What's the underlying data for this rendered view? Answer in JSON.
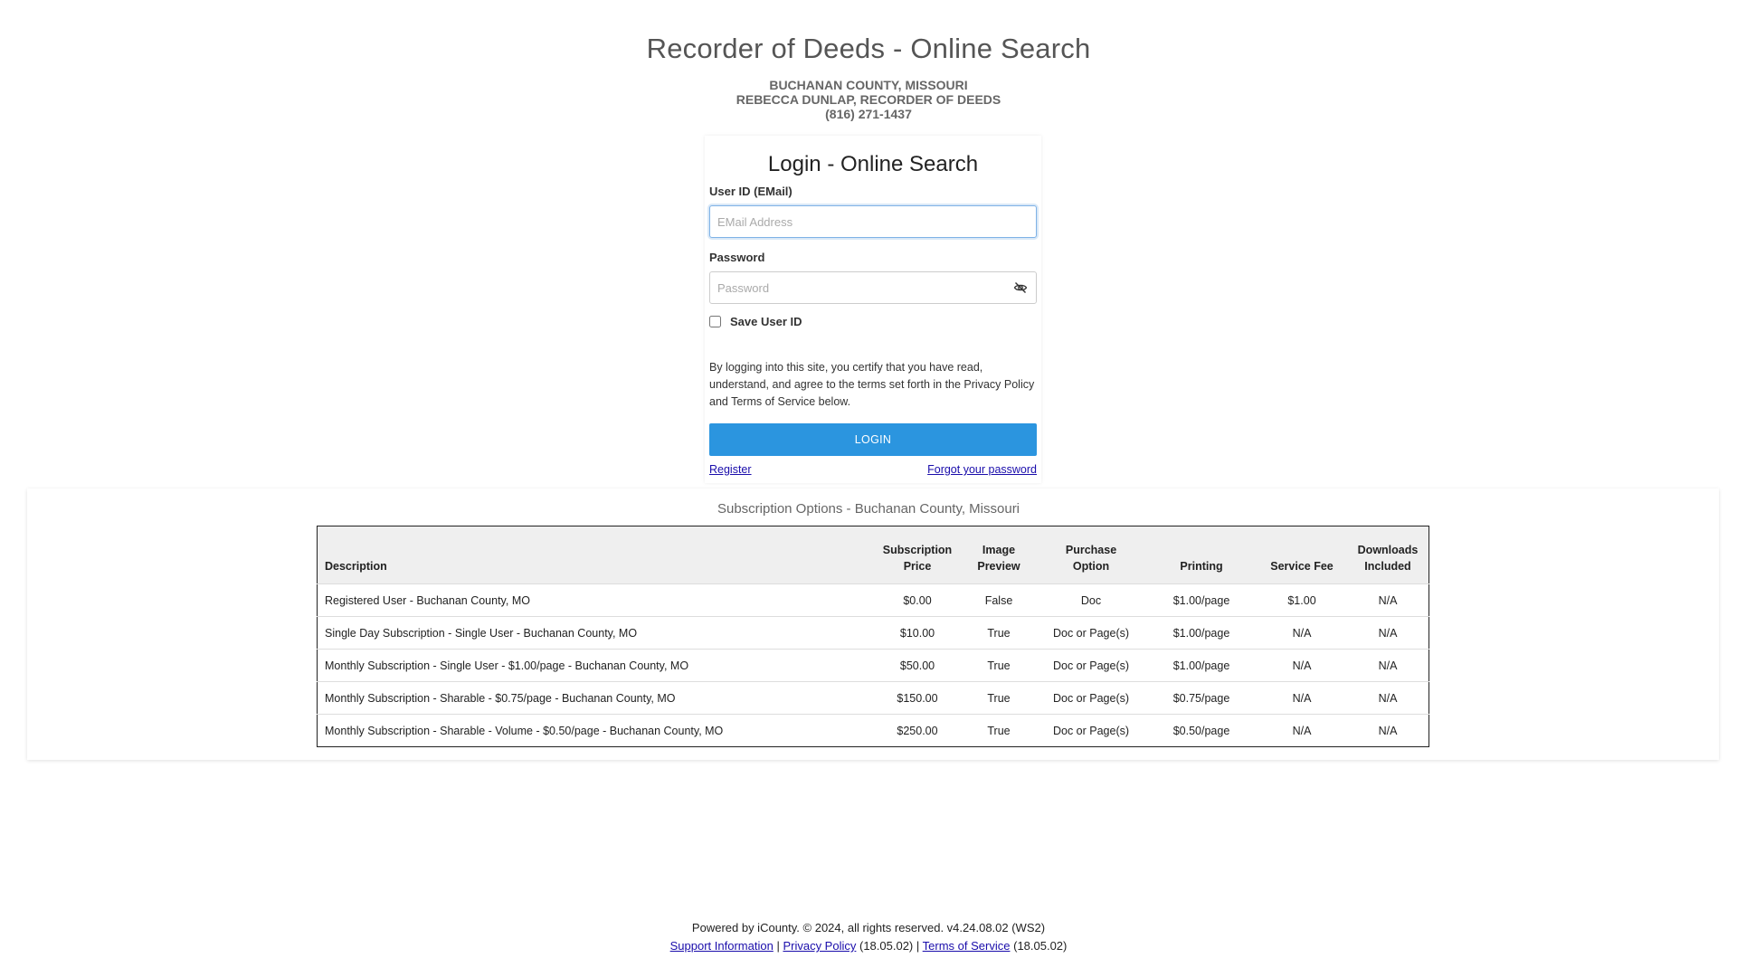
{
  "header": {
    "title": "Recorder of Deeds - Online Search",
    "county": "BUCHANAN COUNTY, MISSOURI",
    "recorder": "REBECCA DUNLAP, RECORDER OF DEEDS",
    "phone": "(816) 271-1437"
  },
  "login": {
    "title": "Login - Online Search",
    "user_label": "User ID (EMail)",
    "user_placeholder": "EMail Address",
    "password_label": "Password",
    "password_placeholder": "Password",
    "save_user_label": "Save User ID",
    "terms_text": "By logging into this site, you certify that you have read, understand, and agree to the terms set forth in the Privacy Policy and Terms of Service below.",
    "login_button": "LOGIN",
    "register_link": "Register",
    "forgot_link": "Forgot your password",
    "accent_color": "#2b95df"
  },
  "subscriptions": {
    "title": "Subscription Options - Buchanan County, Missouri",
    "headers": {
      "description": "Description",
      "price_1": "Subscription",
      "price_2": "Price",
      "preview_1": "Image",
      "preview_2": "Preview",
      "purchase_1": "Purchase",
      "purchase_2": "Option",
      "printing": "Printing",
      "service_fee": "Service Fee",
      "downloads_1": "Downloads",
      "downloads_2": "Included"
    },
    "rows": [
      {
        "description": "Registered User - Buchanan County, MO",
        "price": "$0.00",
        "preview": "False",
        "purchase": "Doc",
        "printing": "$1.00/page",
        "fee": "$1.00",
        "downloads": "N/A"
      },
      {
        "description": "Single Day Subscription - Single User - Buchanan County, MO",
        "price": "$10.00",
        "preview": "True",
        "purchase": "Doc or Page(s)",
        "printing": "$1.00/page",
        "fee": "N/A",
        "downloads": "N/A"
      },
      {
        "description": "Monthly Subscription - Single User - $1.00/page - Buchanan County, MO",
        "price": "$50.00",
        "preview": "True",
        "purchase": "Doc or Page(s)",
        "printing": "$1.00/page",
        "fee": "N/A",
        "downloads": "N/A"
      },
      {
        "description": "Monthly Subscription - Sharable - $0.75/page - Buchanan County, MO",
        "price": "$150.00",
        "preview": "True",
        "purchase": "Doc or Page(s)",
        "printing": "$0.75/page",
        "fee": "N/A",
        "downloads": "N/A"
      },
      {
        "description": "Monthly Subscription - Sharable - Volume - $0.50/page - Buchanan County, MO",
        "price": "$250.00",
        "preview": "True",
        "purchase": "Doc or Page(s)",
        "printing": "$0.50/page",
        "fee": "N/A",
        "downloads": "N/A"
      }
    ]
  },
  "footer": {
    "powered_by": "Powered by iCounty.  © 2024, all rights reserved.  v4.24.08.02 (WS2)",
    "support_link": "Support Information",
    "privacy_link": "Privacy Policy",
    "privacy_version": "(18.05.02)",
    "terms_link": "Terms of Service",
    "terms_version": "(18.05.02)",
    "separator": "|"
  }
}
